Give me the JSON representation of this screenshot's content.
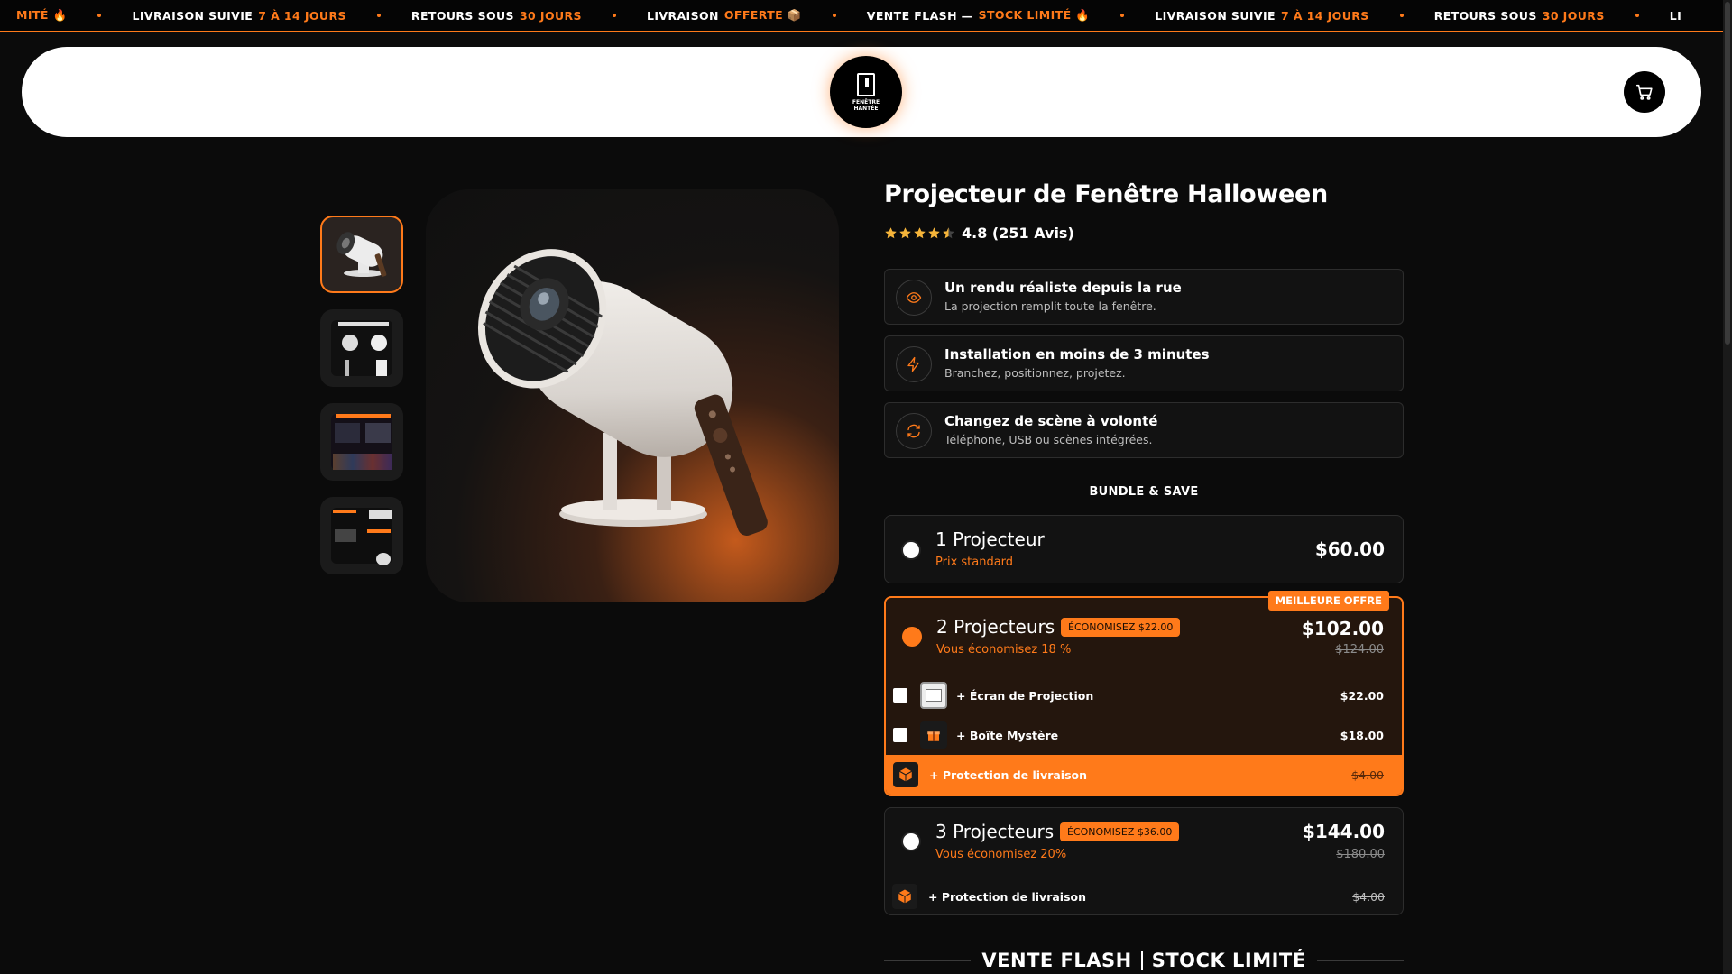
{
  "ticker": {
    "items": [
      {
        "text": "",
        "highlight": "MITÉ 🔥"
      },
      {
        "text": "LIVRAISON SUIVIE",
        "highlight": "7 À 14 JOURS"
      },
      {
        "text": "RETOURS SOUS",
        "highlight": "30 JOURS"
      },
      {
        "text": "LIVRAISON",
        "highlight": "OFFERTE 📦"
      },
      {
        "text": "VENTE FLASH —",
        "highlight": "STOCK LIMITÉ 🔥"
      },
      {
        "text": "LIVRAISON SUIVIE",
        "highlight": "7 À 14 JOURS"
      },
      {
        "text": "RETOURS SOUS",
        "highlight": "30 JOURS"
      },
      {
        "text": "LI",
        "highlight": ""
      }
    ]
  },
  "header": {
    "logo_text": "FENÊTRE HANTÉE"
  },
  "product": {
    "title": "Projecteur de Fenêtre Halloween",
    "rating_text": "4.8 (251 Avis)",
    "rating_value": 4.5,
    "features": [
      {
        "icon": "eye-icon",
        "title": "Un rendu réaliste depuis la rue",
        "subtitle": "La projection remplit toute la fenêtre."
      },
      {
        "icon": "lightning-icon",
        "title": "Installation en moins de 3 minutes",
        "subtitle": "Branchez, positionnez, projetez."
      },
      {
        "icon": "refresh-icon",
        "title": "Changez de scène à volonté",
        "subtitle": "Téléphone, USB ou scènes intégrées."
      }
    ],
    "bundle_heading": "BUNDLE & SAVE",
    "bundles": [
      {
        "name": "1 Projecteur",
        "subtitle": "Prix standard",
        "price": "$60.00"
      },
      {
        "name": "2 Projecteurs",
        "badge": "ÉCONOMISEZ $22.00",
        "subtitle": "Vous économisez 18 %",
        "price": "$102.00",
        "old_price": "$124.00",
        "best_label": "MEILLEURE OFFRE",
        "addons": [
          {
            "label": "+ Écran de Projection",
            "price": "$22.00"
          },
          {
            "label": "+ Boîte Mystère",
            "price": "$18.00"
          }
        ],
        "protection": {
          "label": "+ Protection de livraison",
          "price": "$4.00"
        }
      },
      {
        "name": "3 Projecteurs",
        "badge": "ÉCONOMISEZ $36.00",
        "subtitle": "Vous économisez 20%",
        "price": "$144.00",
        "old_price": "$180.00",
        "protection": {
          "label": "+ Protection de livraison",
          "price": "$4.00"
        }
      }
    ],
    "flash_left": "VENTE FLASH",
    "flash_right": "STOCK LIMITÉ"
  },
  "colors": {
    "accent": "#ff7a1a",
    "background": "#0b0b0b"
  }
}
